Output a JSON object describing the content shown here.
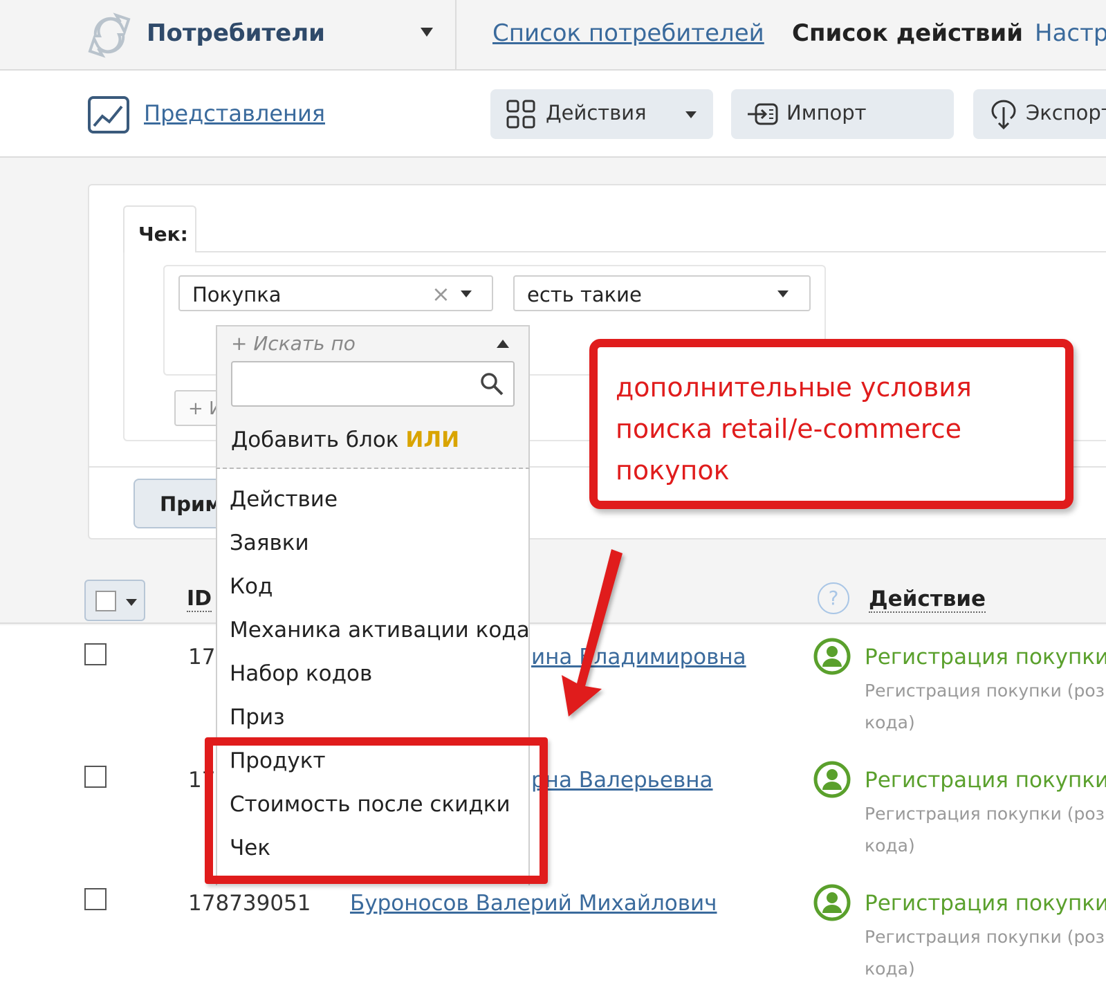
{
  "header": {
    "app_title": "Потребители",
    "nav_list": "Список потребителей",
    "nav_actions": "Список действий",
    "nav_settings": "Настр"
  },
  "toolbar": {
    "views_link": "Представления",
    "actions_label": "Действия",
    "import_label": "Импорт",
    "export_label": "Экспорт"
  },
  "filter": {
    "tab_label": "Чек:",
    "condition_value": "Покупка",
    "operator_value": "есть такие",
    "add_condition_label": "+ И",
    "apply_label": "Прим"
  },
  "dropdown": {
    "search_label": "+ Искать по",
    "add_block_text": "Добавить блок ",
    "add_block_or": "ИЛИ",
    "items": [
      "Действие",
      "Заявки",
      "Код",
      "Механика активации кода",
      "Набор кодов",
      "Приз",
      "Продукт",
      "Стоимость после скидки",
      "Чек"
    ]
  },
  "table": {
    "col_id": "ID",
    "col_action": "Действие",
    "rows": [
      {
        "id": "17",
        "name": "ина Владимировна",
        "action": "Регистрация покупки",
        "desc_line1": "Регистрация покупки (розн",
        "desc_line2": "кода)"
      },
      {
        "id": "17",
        "name": "рна Валерьевна",
        "action": "Регистрация покупки",
        "desc_line1": "Регистрация покупки (розн",
        "desc_line2": "кода)"
      },
      {
        "id": "178739051",
        "name": "Буроносов Валерий Михайлович",
        "action": "Регистрация покупки",
        "desc_line1": "Регистрация покупки (розн",
        "desc_line2": "кода)"
      }
    ]
  },
  "annotation": {
    "callout_text": "дополнительные условия поиска retail/e-commerce покупок",
    "color": "#e01c1c"
  },
  "colors": {
    "link": "#3a6a9c",
    "action_green": "#5aa02c",
    "highlight_gold": "#d9a400"
  }
}
